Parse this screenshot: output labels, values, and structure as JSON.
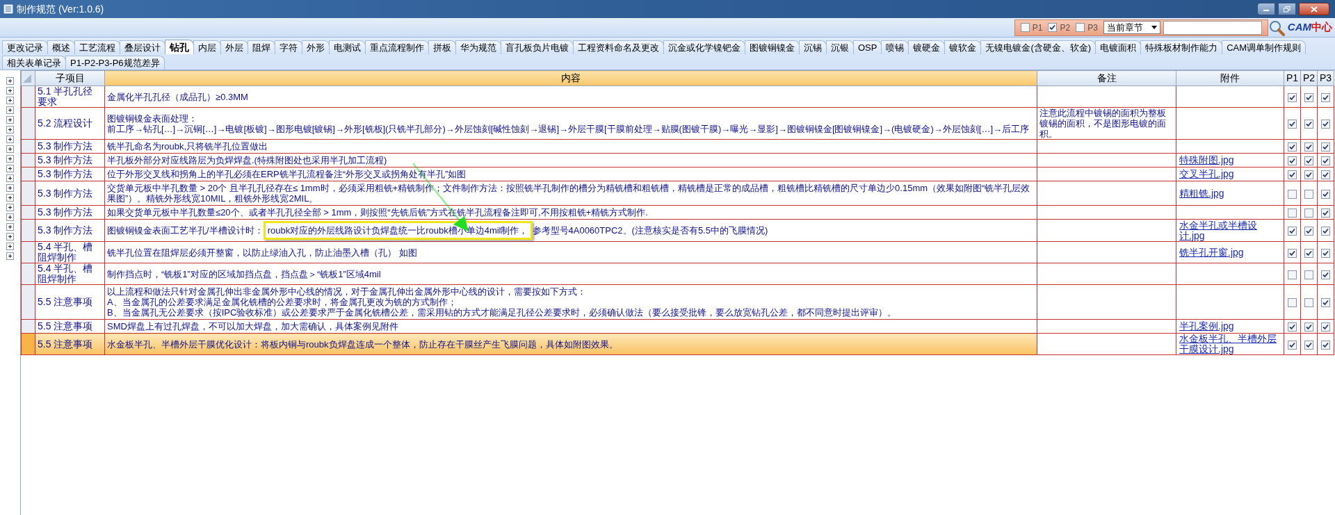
{
  "window": {
    "title": "制作规范 (Ver:1.0.6)"
  },
  "filter": {
    "options": [
      {
        "label": "P1",
        "checked": false
      },
      {
        "label": "P2",
        "checked": true
      },
      {
        "label": "P3",
        "checked": false
      }
    ],
    "scope": "当前章节",
    "logo_a": "CAM",
    "logo_b": "中心"
  },
  "tabs": [
    [
      {
        "label": "更改记录",
        "selected": false
      },
      {
        "label": "概述",
        "selected": false
      },
      {
        "label": "工艺流程",
        "selected": false
      },
      {
        "label": "叠层设计",
        "selected": false
      },
      {
        "label": "钻孔",
        "selected": true
      },
      {
        "label": "内层",
        "selected": false
      },
      {
        "label": "外层",
        "selected": false
      },
      {
        "label": "阻焊",
        "selected": false
      },
      {
        "label": "字符",
        "selected": false
      },
      {
        "label": "外形",
        "selected": false
      },
      {
        "label": "电测试",
        "selected": false
      },
      {
        "label": "重点流程制作",
        "selected": false
      },
      {
        "label": "拼板",
        "selected": false
      },
      {
        "label": "华为规范",
        "selected": false
      },
      {
        "label": "盲孔板负片电镀",
        "selected": false
      },
      {
        "label": "工程资料命名及更改",
        "selected": false
      },
      {
        "label": "沉金或化学镍钯金",
        "selected": false
      },
      {
        "label": "图镀铜镍金",
        "selected": false
      },
      {
        "label": "沉锡",
        "selected": false
      },
      {
        "label": "沉银",
        "selected": false
      },
      {
        "label": "OSP",
        "selected": false
      },
      {
        "label": "喷锡",
        "selected": false
      },
      {
        "label": "镀硬金",
        "selected": false
      },
      {
        "label": "镀软金",
        "selected": false
      },
      {
        "label": "无镍电镀金(含硬金、软金)",
        "selected": false
      },
      {
        "label": "电镀面积",
        "selected": false
      },
      {
        "label": "特殊板材制作能力",
        "selected": false
      },
      {
        "label": "CAM调单制作规则",
        "selected": false
      }
    ],
    [
      {
        "label": "相关表单记录",
        "selected": false
      },
      {
        "label": "P1-P2-P3-P6规范差异",
        "selected": false
      }
    ]
  ],
  "table": {
    "columns": [
      "子项目",
      "内容",
      "备注",
      "附件",
      "P1",
      "P2",
      "P3"
    ],
    "rows": [
      {
        "item": "5.1 半孔孔径要求",
        "content": "金属化半孔孔径（成品孔）≥0.3MM",
        "p": [
          true,
          true,
          true
        ],
        "selected": false
      },
      {
        "item": "5.2 流程设计",
        "content": "图镀铜镍金表面处理：",
        "content_2": "前工序→钻孔[…]→沉铜[…]→电镀[板镀]→图形电镀[镀锡]→外形[铣板](只铣半孔部分)→外层蚀刻[碱性蚀刻→退锡]→外层干膜[干膜前处理→贴膜(图镀干膜)→曝光→显影]→图镀铜镍金[图镀铜镍金]→(电镀硬金)→外层蚀刻[…]→后工序",
        "note": "注意此流程中镀锡的面积为整板镀锡的面积，不是图形电镀的面积。",
        "p": [
          true,
          true,
          true
        ],
        "selected": false
      },
      {
        "item": "5.3 制作方法",
        "content": "铣半孔命名为roubk,只将铣半孔位置做出",
        "p": [
          true,
          true,
          true
        ],
        "selected": false
      },
      {
        "item": "5.3 制作方法",
        "content": "半孔板外部分对应线路层为负焊焊盘.(特殊附图处也采用半孔加工流程)",
        "attachment": "特殊附图.jpg",
        "p": [
          true,
          true,
          true
        ],
        "selected": false
      },
      {
        "item": "5.3 制作方法",
        "content": "位于外形交叉线和拐角上的半孔必须在ERP铣半孔流程备注“外形交叉或拐角处有半孔”如图",
        "attachment": "交叉半孔.jpg",
        "p": [
          true,
          true,
          true
        ],
        "selected": false
      },
      {
        "item": "5.3 制作方法",
        "content": "交货单元板中半孔数量 > 20个 且半孔孔径存在≤ 1mm时，必须采用粗铣+精铣制作；文件制作方法：按照铣半孔制作的槽分为精铣槽和粗铣槽，精铣槽是正常的成品槽，粗铣槽比精铣槽的尺寸单边少0.15mm（效果如附图“铣半孔层效果图”）。精铣外形线宽10MIL，粗铣外形线宽2MIL。",
        "attachment": "精粗铣.jpg",
        "p": [
          false,
          false,
          true
        ],
        "selected": false
      },
      {
        "item": "5.3 制作方法",
        "content": "如果交货单元板中半孔数量≤20个、或者半孔孔径全部 > 1mm，则按照“先铣后铣”方式在铣半孔流程备注即可,不用按粗铣+精铣方式制作.",
        "p": [
          false,
          false,
          true
        ],
        "selected": false
      },
      {
        "item": "5.3 制作方法",
        "content": "图镀铜镍金表面工艺半孔/半槽设计时：",
        "highlight": "roubk对应的外层线路设计负焊盘统一比roubk槽小单边4mil制作，",
        "content_after": "参考型号4A0060TPC2。(注意核实是否有5.5中的飞膜情况)",
        "attachment": "水金半孔或半槽设计.jpg",
        "p": [
          true,
          true,
          true
        ],
        "selected": false
      },
      {
        "item": "5.4 半孔、槽阻焊制作",
        "content": "铣半孔位置在阻焊层必须开整窗，以防止绿油入孔，防止油墨入槽（孔）  如图",
        "attachment": "铣半孔开窗.jpg",
        "p": [
          true,
          true,
          true
        ],
        "selected": false
      },
      {
        "item": "5.4 半孔、槽阻焊制作",
        "content": "制作挡点时，“铣板1”对应的区域加挡点盘，挡点盘＞“铣板1”区域4mil",
        "p": [
          false,
          false,
          true
        ],
        "selected": false
      },
      {
        "item": "5.5 注意事项",
        "content": "以上流程和做法只针对金属孔伸出非金属外形中心线的情况，对于金属孔伸出金属外形中心线的设计，需要按如下方式：",
        "content_2": "A、当金属孔的公差要求满足金属化铣槽的公差要求时，将金属孔更改为铣的方式制作；",
        "content_3": "B、当金属孔无公差要求（按IPC验收标准）或公差要求严于金属化铣槽公差，需采用钻的方式才能满足孔径公差要求时，必须确认做法（要么接受批锋，要么放宽钻孔公差，都不同意时提出评审）。",
        "p": [
          false,
          false,
          true
        ],
        "selected": false
      },
      {
        "item": "5.5 注意事项",
        "content": "SMD焊盘上有过孔焊盘，不可以加大焊盘，加大需确认，具体案例见附件",
        "attachment": "半孔案例.jpg",
        "p": [
          true,
          true,
          true
        ],
        "selected": false
      },
      {
        "item": "5.5 注意事项",
        "content": "水金板半孔、半槽外层干膜优化设计：将板内铜与roubk负焊盘连成一个整体，防止存在干膜丝产生飞膜问题，具体如附图效果。",
        "attachment": "水金板半孔、半槽外层干膜设计.jpg",
        "p": [
          true,
          true,
          true
        ],
        "selected": true
      }
    ]
  }
}
